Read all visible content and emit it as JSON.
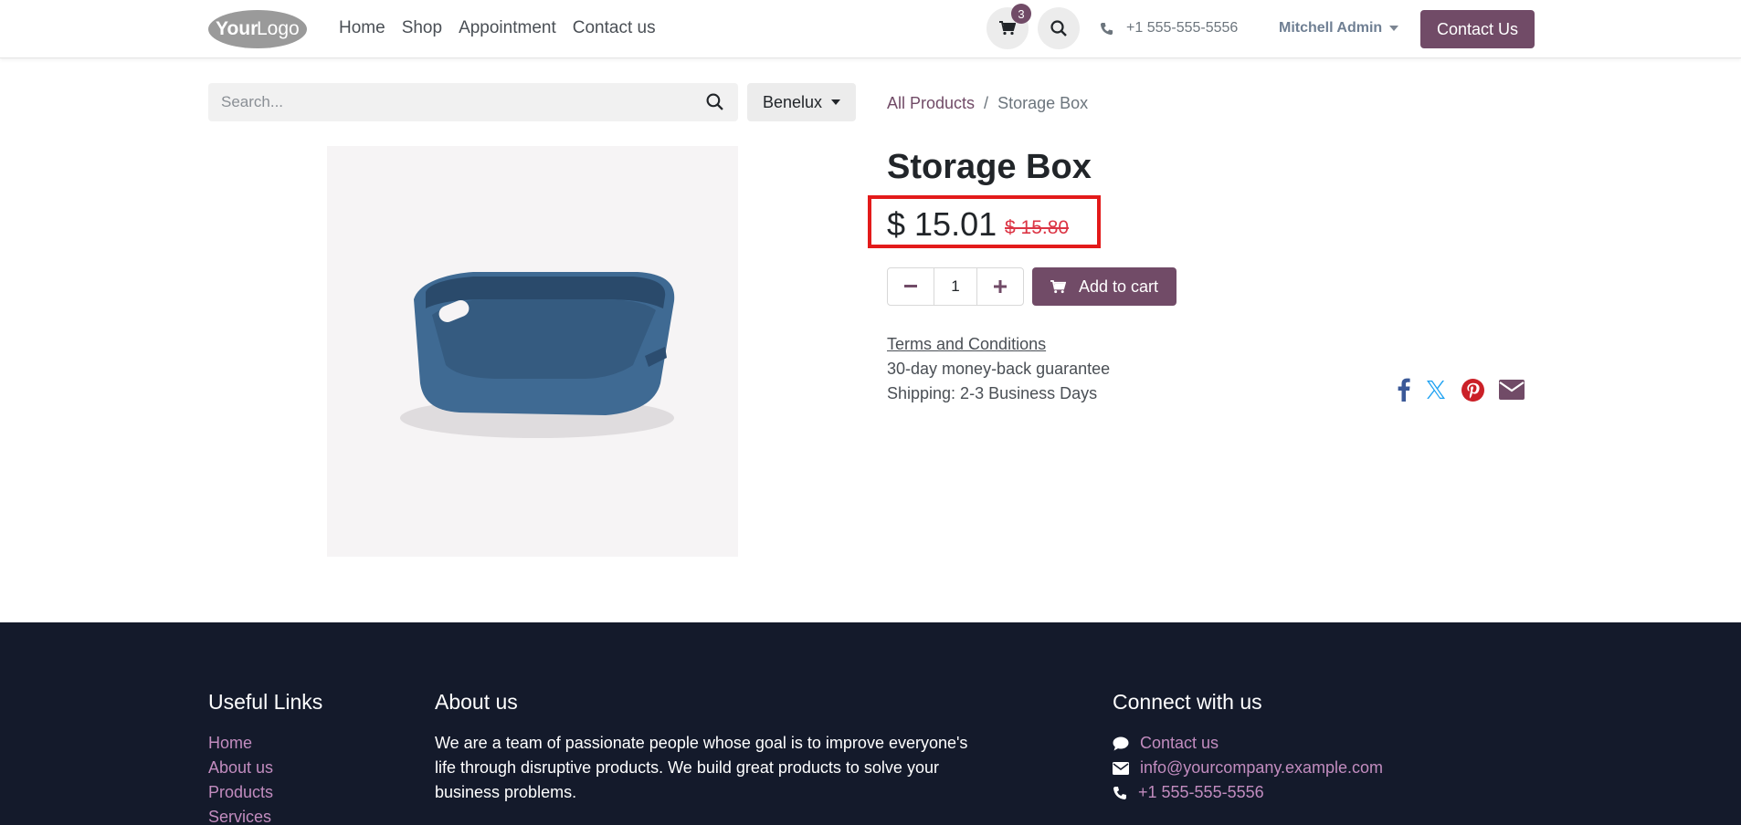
{
  "header": {
    "logo_text": "YourLogo",
    "nav": [
      "Home",
      "Shop",
      "Appointment",
      "Contact us"
    ],
    "cart_count": "3",
    "phone": "+1 555-555-5556",
    "user": "Mitchell Admin",
    "contact_button": "Contact Us"
  },
  "search": {
    "placeholder": "Search...",
    "pricelist": "Benelux"
  },
  "breadcrumb": {
    "all": "All Products",
    "sep": "/",
    "current": "Storage Box"
  },
  "product": {
    "title": "Storage Box",
    "price": "$ 15.01",
    "old_price": "$ 15.80",
    "quantity": "1",
    "add_to_cart": "Add to cart",
    "terms": "Terms and Conditions",
    "guarantee": "30-day money-back guarantee",
    "shipping": "Shipping: 2-3 Business Days"
  },
  "footer": {
    "useful_links_title": "Useful Links",
    "useful_links": [
      "Home",
      "About us",
      "Products",
      "Services"
    ],
    "about_title": "About us",
    "about_text": "We are a team of passionate people whose goal is to improve everyone's life through disruptive products. We build great products to solve your business problems.",
    "connect_title": "Connect with us",
    "connect_contact": "Contact us",
    "connect_email": "info@yourcompany.example.com",
    "connect_phone": "+1 555-555-5556"
  },
  "colors": {
    "brand": "#714b67",
    "footer_bg": "#141a2b",
    "highlight_box": "#e31a1a",
    "old_price": "#dc3545"
  },
  "icons": [
    "cart-icon",
    "search-icon",
    "phone-icon",
    "minus-icon",
    "plus-icon",
    "facebook-icon",
    "x-icon",
    "pinterest-icon",
    "email-icon",
    "chat-icon",
    "envelope-icon"
  ]
}
